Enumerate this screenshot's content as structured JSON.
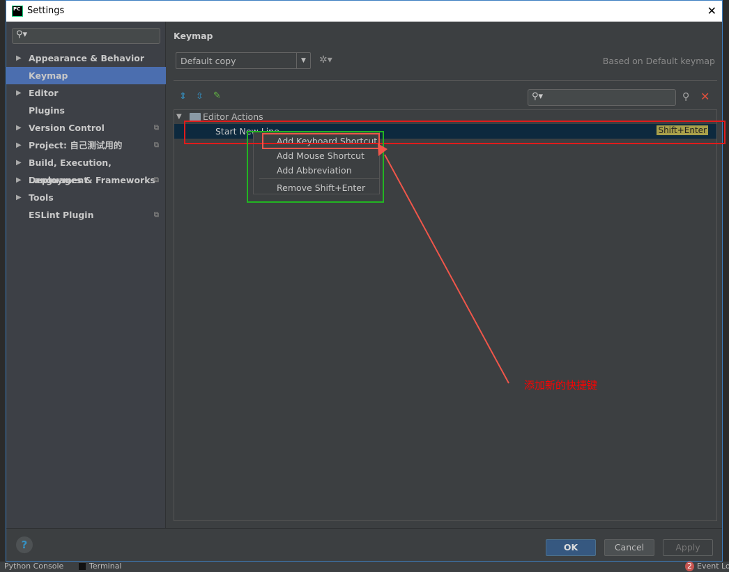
{
  "window": {
    "title": "Settings",
    "close": "✕"
  },
  "sidebar": {
    "items": [
      {
        "label": "Appearance & Behavior",
        "arrow": true
      },
      {
        "label": "Keymap",
        "selected": true
      },
      {
        "label": "Editor",
        "arrow": true
      },
      {
        "label": "Plugins"
      },
      {
        "label": "Version Control",
        "arrow": true,
        "copy": true
      },
      {
        "label": "Project: 自己测试用的",
        "arrow": true,
        "copy": true
      },
      {
        "label": "Build, Execution, Deployment",
        "arrow": true
      },
      {
        "label": "Languages & Frameworks",
        "arrow": true,
        "copy": true
      },
      {
        "label": "Tools",
        "arrow": true
      },
      {
        "label": "ESLint Plugin",
        "copy": true
      }
    ]
  },
  "main": {
    "title": "Keymap",
    "keymap_select": "Default copy",
    "based_on": "Based on Default keymap",
    "tree": {
      "group": "Editor Actions",
      "action": "Start New Line",
      "shortcut": "Shift+Enter"
    },
    "context_menu": [
      "Add Keyboard Shortcut",
      "Add Mouse Shortcut",
      "Add Abbreviation",
      "Remove Shift+Enter"
    ]
  },
  "annotation": {
    "text": "添加新的快捷键",
    "color": "#ff0000"
  },
  "footer": {
    "ok": "OK",
    "cancel": "Cancel",
    "apply": "Apply",
    "help": "?"
  },
  "statusbar": {
    "python_console": "Python Console",
    "terminal": "Terminal",
    "event_log": "Event Log",
    "event_count": "2"
  }
}
